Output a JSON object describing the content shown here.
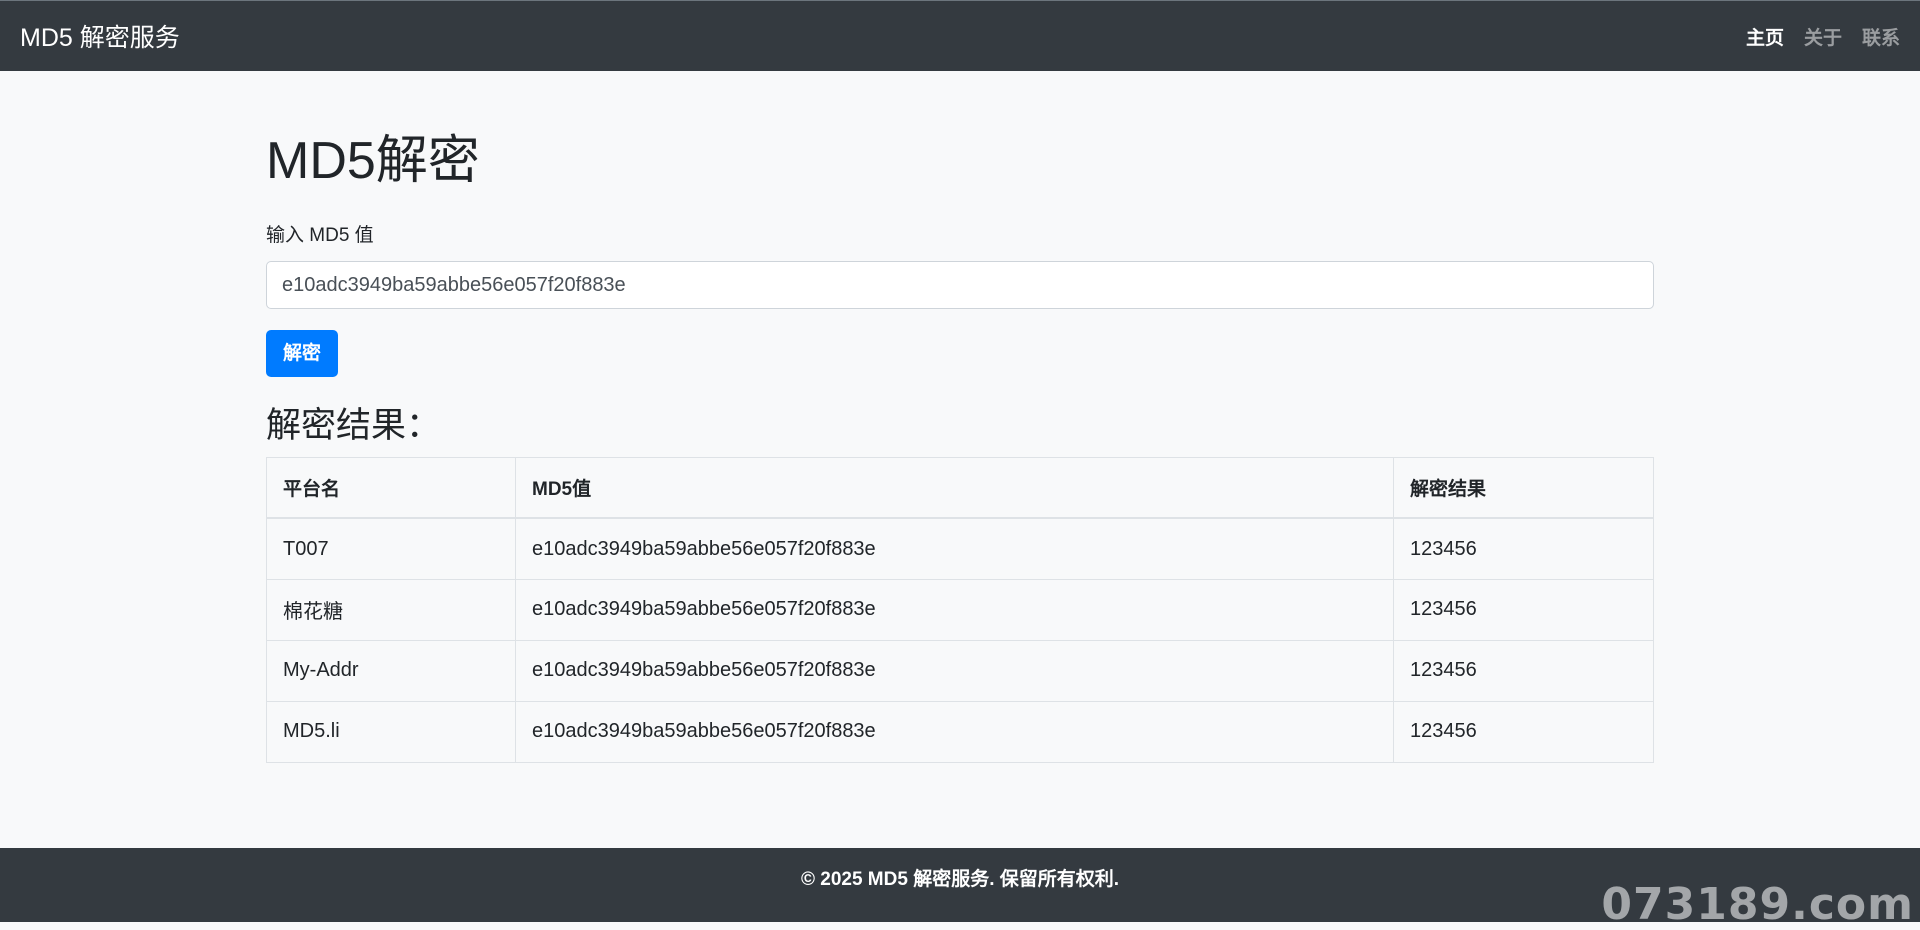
{
  "navbar": {
    "brand": "MD5 解密服务",
    "links": [
      {
        "label": "主页"
      },
      {
        "label": "关于"
      },
      {
        "label": "联系"
      }
    ]
  },
  "main": {
    "title": "MD5解密",
    "input_label": "输入 MD5 值",
    "input_value": "e10adc3949ba59abbe56e057f20f883e",
    "button_label": "解密",
    "result_title": "解密结果："
  },
  "table": {
    "headers": [
      "平台名",
      "MD5值",
      "解密结果"
    ],
    "rows": [
      [
        "T007",
        "e10adc3949ba59abbe56e057f20f883e",
        "123456"
      ],
      [
        "棉花糖",
        "e10adc3949ba59abbe56e057f20f883e",
        "123456"
      ],
      [
        "My-Addr",
        "e10adc3949ba59abbe56e057f20f883e",
        "123456"
      ],
      [
        "MD5.li",
        "e10adc3949ba59abbe56e057f20f883e",
        "123456"
      ]
    ]
  },
  "footer": {
    "text": "© 2025 MD5 解密服务. 保留所有权利."
  },
  "watermark": "073189.com",
  "colors": {
    "navbar_bg": "#343a40",
    "page_bg": "#f8f9fa",
    "accent": "#007bff"
  }
}
